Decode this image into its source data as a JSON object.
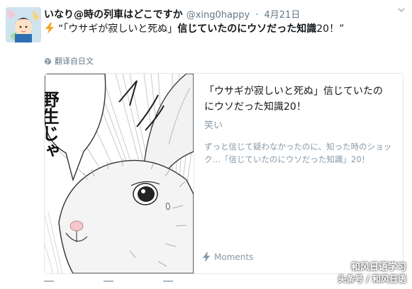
{
  "tweet": {
    "display_name": "いなり@時の列車はどこですか",
    "handle": "@xing0happy",
    "separator": "·",
    "date": "4月21日",
    "text_quote_open": "“「ウサギが寂しいと死ぬ」",
    "text_bold": "信じていたのにウソだった知識",
    "text_tail": "20！”",
    "translate_label": "翻译自日文"
  },
  "card": {
    "title": "「ウサギが寂しいと死ぬ」信じていたのにウソだった知識20！",
    "category": "笑い",
    "description": "ずっと信じて疑わなかったのに、知った時のショック…「信じていたのにウソだった知識」20！",
    "footer_label": "Moments",
    "manga_caption": "野生じゃ"
  },
  "watermark": {
    "line1": "和风日语学习",
    "line2": "头条号 / 和风日语"
  },
  "icons": {
    "avatar": "avatar-image",
    "caret": "chevron-down-icon",
    "bolt": "lightning-icon",
    "globe": "globe-icon",
    "moments": "lightning-icon"
  },
  "colors": {
    "secondary_text": "#657786",
    "bolt": "#f5a623",
    "card_border": "#e1e8ed"
  }
}
